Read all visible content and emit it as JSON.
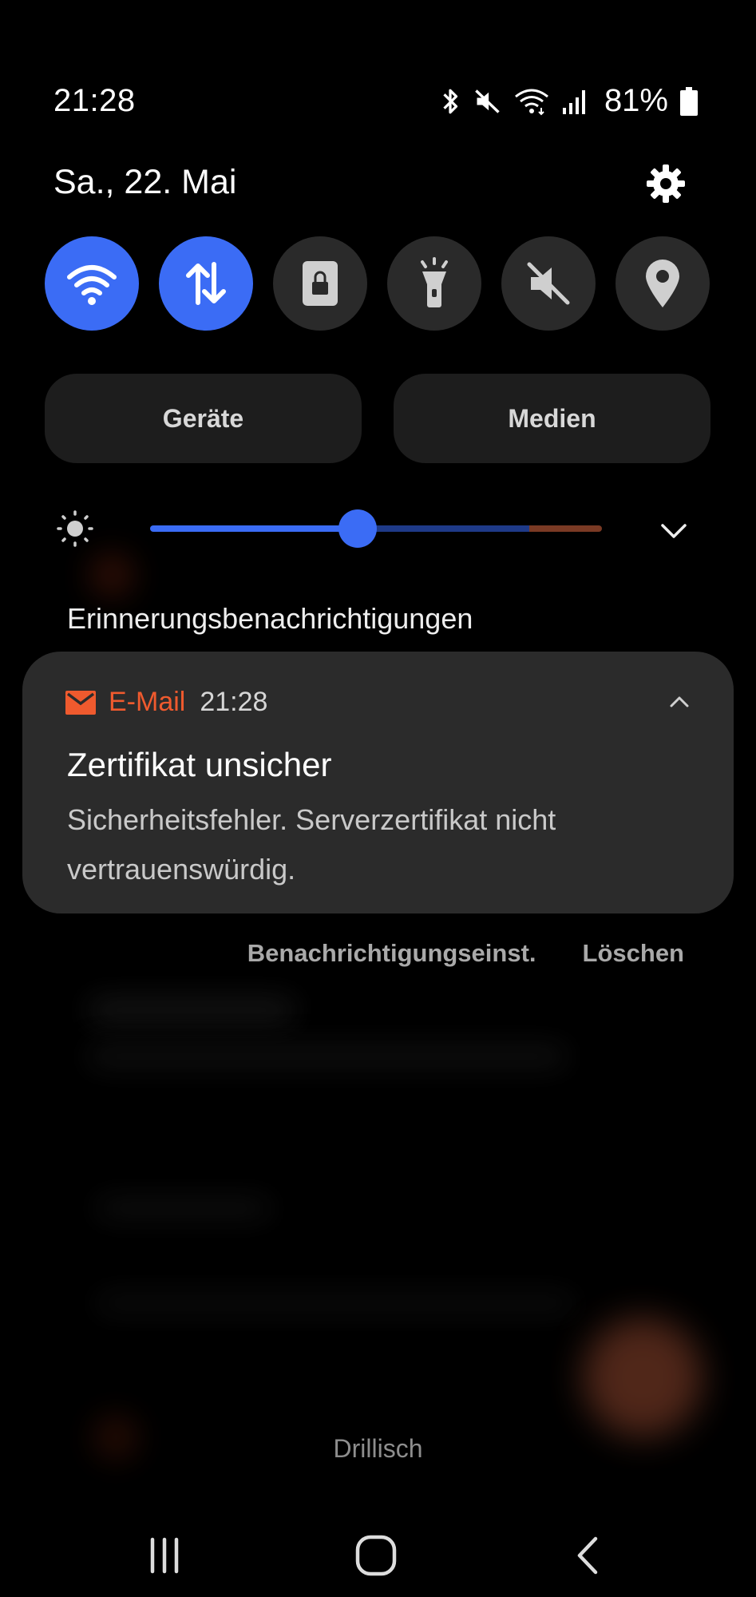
{
  "status_bar": {
    "time": "21:28",
    "battery_percent": "81%",
    "icons": [
      "bluetooth-icon",
      "mute-icon",
      "wifi-icon",
      "signal-icon",
      "battery-icon"
    ]
  },
  "header": {
    "date": "Sa., 22. Mai",
    "settings_icon": "gear-icon"
  },
  "quick_tiles": [
    {
      "icon": "wifi-icon",
      "state": "on"
    },
    {
      "icon": "mobile-data-icon",
      "state": "on"
    },
    {
      "icon": "screen-lock-icon",
      "state": "off"
    },
    {
      "icon": "flashlight-icon",
      "state": "off"
    },
    {
      "icon": "sound-mute-icon",
      "state": "off"
    },
    {
      "icon": "location-icon",
      "state": "off"
    }
  ],
  "panel_buttons": {
    "devices": "Geräte",
    "media": "Medien"
  },
  "brightness": {
    "level": 0.46,
    "accent_color": "#3b6cf5"
  },
  "notifications": {
    "section_title": "Erinnerungsbenachrichtigungen",
    "card": {
      "app_icon": "email-icon",
      "app_name": "E-Mail",
      "app_color": "#ef5a2e",
      "time": "21:28",
      "title": "Zertifikat unsicher",
      "body": "Sicherheitsfehler. Serverzertifikat nicht vertrauenswürdig."
    },
    "actions": {
      "settings": "Benachrichtigungseinst.",
      "clear": "Löschen"
    }
  },
  "carrier": "Drillisch",
  "navigation": {
    "recents_icon": "recents-icon",
    "home_icon": "home-icon",
    "back_icon": "back-icon"
  }
}
